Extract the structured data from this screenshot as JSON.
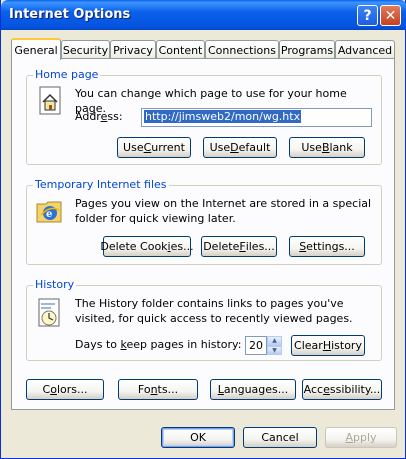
{
  "window": {
    "title": "Internet Options",
    "help_glyph": "?",
    "close_glyph": "✕"
  },
  "tabs": [
    {
      "label": "General",
      "active": true
    },
    {
      "label": "Security"
    },
    {
      "label": "Privacy"
    },
    {
      "label": "Content"
    },
    {
      "label": "Connections"
    },
    {
      "label": "Programs"
    },
    {
      "label": "Advanced"
    }
  ],
  "home_page": {
    "title": "Home page",
    "icon": "home-page-icon",
    "description": "You can change which page to use for your home page.",
    "address_label": "Address:",
    "address_value": "http://jimsweb2/mon/wg.htx",
    "buttons": [
      "Use Current",
      "Use Default",
      "Use Blank"
    ]
  },
  "temp_files": {
    "title": "Temporary Internet files",
    "icon": "temporary-files-icon",
    "description": "Pages you view on the Internet are stored in a special folder for quick viewing later.",
    "buttons": [
      "Delete Cookies...",
      "Delete Files...",
      "Settings..."
    ]
  },
  "history": {
    "title": "History",
    "icon": "history-icon",
    "description": "The History folder contains links to pages you've visited, for quick access to recently viewed pages.",
    "days_label": "Days to keep pages in history:",
    "days_value": "20",
    "clear_button": "Clear History"
  },
  "bottom_buttons": [
    "Colors...",
    "Fonts...",
    "Languages...",
    "Accessibility..."
  ],
  "dialog_buttons": {
    "ok": "OK",
    "cancel": "Cancel",
    "apply": "Apply"
  },
  "colors": {
    "group_title": "#0046d5",
    "titlebar": "#0a5fe8",
    "selection": "#316ac5"
  }
}
